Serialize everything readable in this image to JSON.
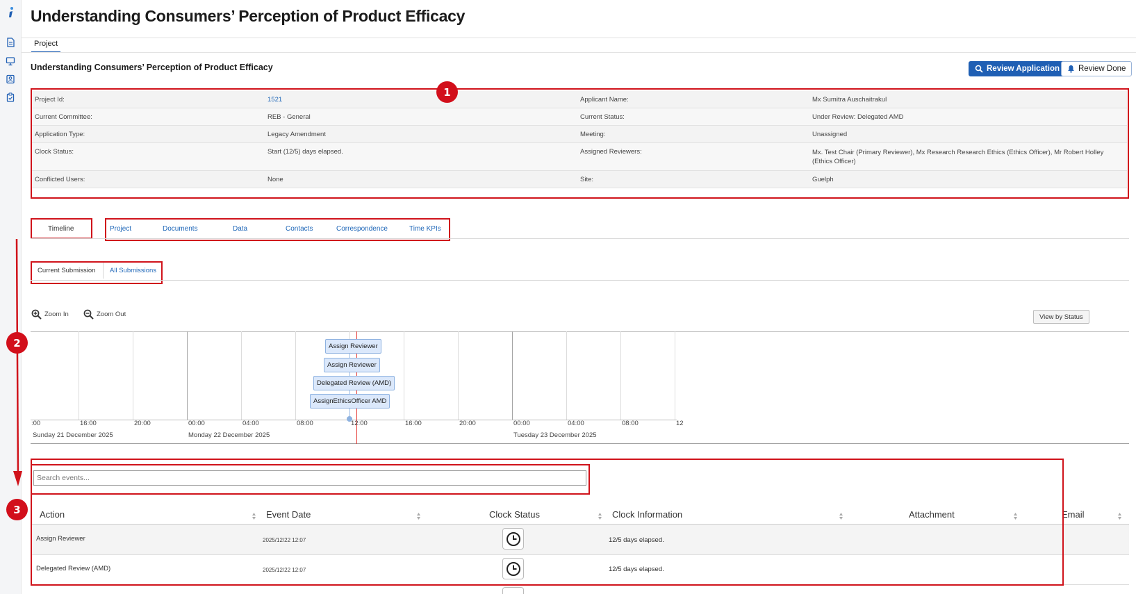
{
  "page": {
    "title": "Understanding Consumers’ Perception of Product Efficacy"
  },
  "tabs": {
    "project": "Project"
  },
  "section": {
    "title": "Understanding Consumers’ Perception of Product Efficacy"
  },
  "buttons": {
    "review_application": "Review Application",
    "review_done": "Review Done"
  },
  "info": {
    "rows": [
      {
        "l1": "Project Id:",
        "v1": "1521",
        "l2": "Applicant Name:",
        "v2": "Mx Sumitra Auschaitrakul"
      },
      {
        "l1": "Current Committee:",
        "v1": "REB - General",
        "l2": "Current Status:",
        "v2": "Under Review: Delegated AMD"
      },
      {
        "l1": "Application Type:",
        "v1": "Legacy Amendment",
        "l2": "Meeting:",
        "v2": "Unassigned"
      },
      {
        "l1": "Clock Status:",
        "v1": "Start (12/5) days elapsed.",
        "l2": "Assigned Reviewers:",
        "v2": "Mx. Test Chair (Primary Reviewer), Mx Research Research Ethics (Ethics Officer), Mr Robert Holley (Ethics Officer)"
      },
      {
        "l1": "Conflicted Users:",
        "v1": "None",
        "l2": "Site:",
        "v2": "Guelph"
      }
    ]
  },
  "subtabs": {
    "timeline": "Timeline",
    "project": "Project",
    "documents": "Documents",
    "data": "Data",
    "contacts": "Contacts",
    "correspondence": "Correspondence",
    "time_kpis": "Time KPIs"
  },
  "submissions": {
    "current": "Current Submission",
    "all": "All Submissions"
  },
  "timeline": {
    "zoom_in": "Zoom In",
    "zoom_out": "Zoom Out",
    "view_by_status": "View by Status",
    "events": [
      "Assign Reviewer",
      "Assign Reviewer",
      "Delegated Review (AMD)",
      "AssignEthicsOfficer AMD"
    ],
    "ticks": [
      ":00",
      "16:00",
      "20:00",
      "00:00",
      "04:00",
      "08:00",
      "12:00",
      "16:00",
      "20:00",
      "00:00",
      "04:00",
      "08:00",
      "12"
    ],
    "days": [
      "Sunday 21 December 2025",
      "Monday 22 December 2025",
      "Tuesday 23 December 2025"
    ]
  },
  "events_table": {
    "search_placeholder": "Search events...",
    "headers": [
      "Action",
      "Event Date",
      "Clock Status",
      "Clock Information",
      "Attachment",
      "Email"
    ],
    "rows": [
      {
        "action": "Assign Reviewer",
        "date": "2025/12/22 12:07",
        "info": "12/5 days elapsed."
      },
      {
        "action": "Delegated Review (AMD)",
        "date": "2025/12/22 12:07",
        "info": "12/5 days elapsed."
      }
    ]
  },
  "annotations": {
    "badge1": "1",
    "badge2": "2",
    "badge3": "3"
  },
  "colors": {
    "accent": "#1f5fb4",
    "annotation_red": "#d0131b",
    "link": "#1f67b8"
  },
  "icons": {
    "sidebar": [
      "logo-icon",
      "document-icon",
      "monitor-icon",
      "id-card-icon",
      "clipboard-icon"
    ],
    "buttons": [
      "search-icon",
      "bell-icon"
    ],
    "zoom": [
      "zoom-in-icon",
      "zoom-out-icon"
    ],
    "clock": "clock-icon"
  }
}
